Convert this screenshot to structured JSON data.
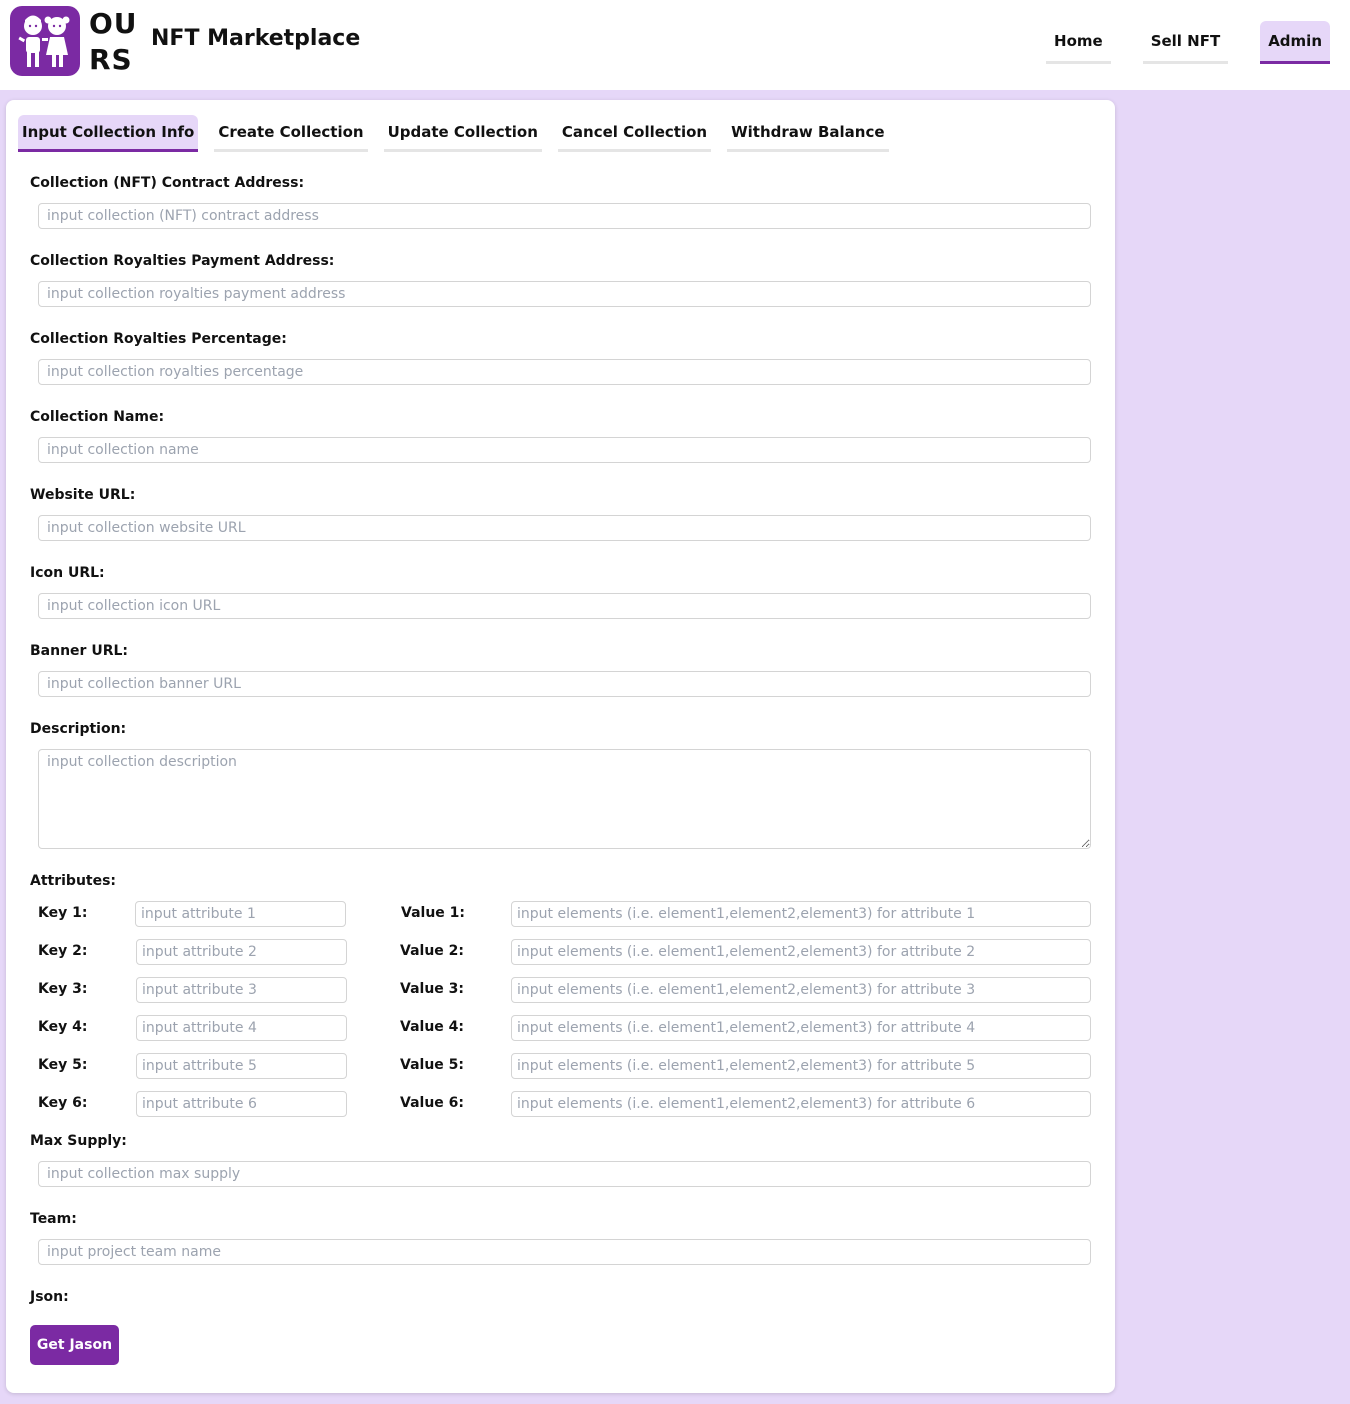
{
  "brand": {
    "logo_text_line1": "OU",
    "logo_text_line2": "RS",
    "name": "NFT Marketplace",
    "accent_color": "#7b2aa3"
  },
  "nav": {
    "items": [
      {
        "label": "Home",
        "active": false
      },
      {
        "label": "Sell NFT",
        "active": false
      },
      {
        "label": "Admin",
        "active": true
      }
    ]
  },
  "tabs": [
    {
      "label": "Input Collection Info",
      "active": true
    },
    {
      "label": "Create Collection",
      "active": false
    },
    {
      "label": "Update Collection",
      "active": false
    },
    {
      "label": "Cancel Collection",
      "active": false
    },
    {
      "label": "Withdraw Balance",
      "active": false
    }
  ],
  "form": {
    "contract_address": {
      "label": "Collection (NFT) Contract Address:",
      "placeholder": "input collection (NFT) contract address",
      "value": ""
    },
    "royalties_address": {
      "label": "Collection Royalties Payment Address:",
      "placeholder": "input collection royalties payment address",
      "value": ""
    },
    "royalties_percentage": {
      "label": "Collection Royalties Percentage:",
      "placeholder": "input collection royalties percentage",
      "value": ""
    },
    "name": {
      "label": "Collection Name:",
      "placeholder": "input collection name",
      "value": ""
    },
    "website": {
      "label": "Website URL:",
      "placeholder": "input collection website URL",
      "value": ""
    },
    "icon": {
      "label": "Icon URL:",
      "placeholder": "input collection icon URL",
      "value": ""
    },
    "banner": {
      "label": "Banner URL:",
      "placeholder": "input collection banner URL",
      "value": ""
    },
    "description": {
      "label": "Description:",
      "placeholder": "input collection description",
      "value": ""
    },
    "attributes_label": "Attributes:",
    "attributes": [
      {
        "key_label": "Key 1:",
        "key_placeholder": "input attribute 1",
        "value_label": "Value 1:",
        "value_placeholder": "input elements (i.e. element1,element2,element3) for attribute 1"
      },
      {
        "key_label": "Key 2:",
        "key_placeholder": "input attribute 2",
        "value_label": "Value 2:",
        "value_placeholder": "input elements (i.e. element1,element2,element3) for attribute 2"
      },
      {
        "key_label": "Key 3:",
        "key_placeholder": "input attribute 3",
        "value_label": "Value 3:",
        "value_placeholder": "input elements (i.e. element1,element2,element3) for attribute 3"
      },
      {
        "key_label": "Key 4:",
        "key_placeholder": "input attribute 4",
        "value_label": "Value 4:",
        "value_placeholder": "input elements (i.e. element1,element2,element3) for attribute 4"
      },
      {
        "key_label": "Key 5:",
        "key_placeholder": "input attribute 5",
        "value_label": "Value 5:",
        "value_placeholder": "input elements (i.e. element1,element2,element3) for attribute 5"
      },
      {
        "key_label": "Key 6:",
        "key_placeholder": "input attribute 6",
        "value_label": "Value 6:",
        "value_placeholder": "input elements (i.e. element1,element2,element3) for attribute 6"
      }
    ],
    "max_supply": {
      "label": "Max Supply:",
      "placeholder": "input collection max supply",
      "value": ""
    },
    "team": {
      "label": "Team:",
      "placeholder": "input project team name",
      "value": ""
    },
    "json_label": "Json:",
    "get_json_button": "Get Jason"
  }
}
